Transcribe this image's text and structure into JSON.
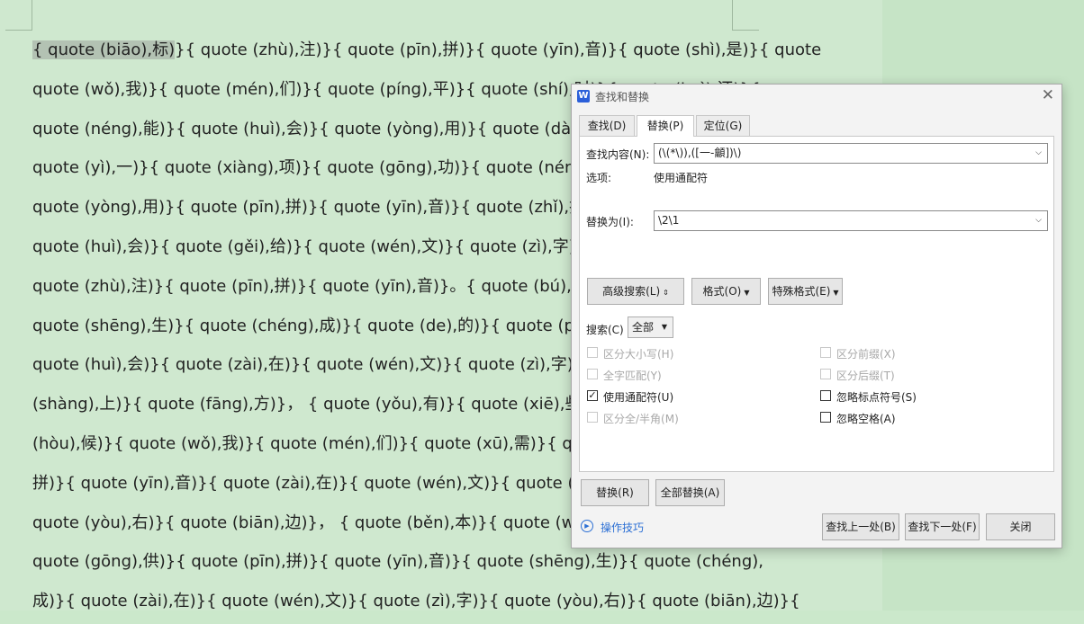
{
  "document": {
    "lines": [
      "<span class='sel'>{ quote (biāo),标)</span>}{ quote (zhù),注)}{ quote (pīn),拼)}{ quote (yīn),音)}{ quote (shì),是)}{ quote",
      "quote (wǒ),我)}{ quote (mén),们)}{ quote (píng),平)}{ quote (shí),时)}{ quote (huì),还)}{",
      "quote (néng),能)}{ quote (huì),会)}{ quote (yòng),用)}{ quote (dào),到)}{",
      "quote (yì),一)}{ quote (xiàng),项)}{ quote (gōng),功)}{ quote (néng),能)}{",
      "quote (yòng),用)}{ quote (pīn),拼)}{ quote (yīn),音)}{ quote (zhǐ),指)}{",
      "quote (huì),会)}{ quote (gěi),给)}{ quote (wén),文)}{ quote (zì),字)}{",
      "quote (zhù),注)}{ quote (pīn),拼)}{ quote (yīn),音)}。{ quote (bú),不)}{",
      "quote (shēng),生)}{ quote (chéng),成)}{ quote (de),的)}{ quote (pīn),拼)}{",
      "quote (huì),会)}{ quote (zài),在)}{ quote (wén),文)}{ quote (zì),字)}{ quote",
      "(shàng),上)}{ quote (fāng),方)}， { quote (yǒu),有)}{ quote (xiē),些)}{ quote",
      "(hòu),候)}{ quote (wǒ),我)}{ quote (mén),们)}{ quote (xū),需)}{ quote (yào),要)}{",
      "拼)}{ quote (yīn),音)}{ quote (zài),在)}{ quote (wén),文)}{ quote (zì),字)}{",
      "quote (yòu),右)}{ quote (biān),边)}， { quote (běn),本)}{ quote (wén),文)}{",
      "quote (gōng),供)}{ quote (pīn),拼)}{ quote (yīn),音)}{ quote (shēng),生)}{ quote (chéng),",
      "成)}{ quote (zài),在)}{ quote (wén),文)}{ quote (zì),字)}{ quote (yòu),右)}{ quote (biān),边)}{"
    ]
  },
  "dialog": {
    "title": "查找和替换",
    "icon_letter": "W",
    "close_glyph": "✕",
    "tabs": [
      "查找(D)",
      "替换(P)",
      "定位(G)"
    ],
    "active_tab": 1,
    "find_label": "查找内容(N):",
    "find_value": "(\\(*\\)),([一-龥])\\)",
    "options_label": "选项:",
    "options_value": "使用通配符",
    "replace_label": "替换为(I):",
    "replace_value": "\\2\\1",
    "advanced_button": "高级搜索(L)",
    "advanced_glyph": "⇕",
    "format_button": "格式(O)",
    "special_button": "特殊格式(E)",
    "dropdown_glyph": "▼",
    "search_label": "搜索(C)",
    "search_value": "全部",
    "checkboxes_left": [
      {
        "label": "区分大小写(H)",
        "checked": false,
        "disabled": true
      },
      {
        "label": "全字匹配(Y)",
        "checked": false,
        "disabled": true
      },
      {
        "label": "使用通配符(U)",
        "checked": true,
        "disabled": false
      },
      {
        "label": "区分全/半角(M)",
        "checked": false,
        "disabled": true
      }
    ],
    "checkboxes_right": [
      {
        "label": "区分前缀(X)",
        "checked": false,
        "disabled": true
      },
      {
        "label": "区分后缀(T)",
        "checked": false,
        "disabled": true
      },
      {
        "label": "忽略标点符号(S)",
        "checked": false,
        "disabled": false
      },
      {
        "label": "忽略空格(A)",
        "checked": false,
        "disabled": false
      }
    ],
    "replace_button": "替换(R)",
    "replace_all_button": "全部替换(A)",
    "tips_link": "操作技巧",
    "find_prev_button": "查找上一处(B)",
    "find_next_button": "查找下一处(F)",
    "close_button": "关闭"
  },
  "colors": {
    "doc_bg": "#cfe8cf",
    "link": "#2b6fd4",
    "dialog_bg": "#f3f3f3"
  }
}
